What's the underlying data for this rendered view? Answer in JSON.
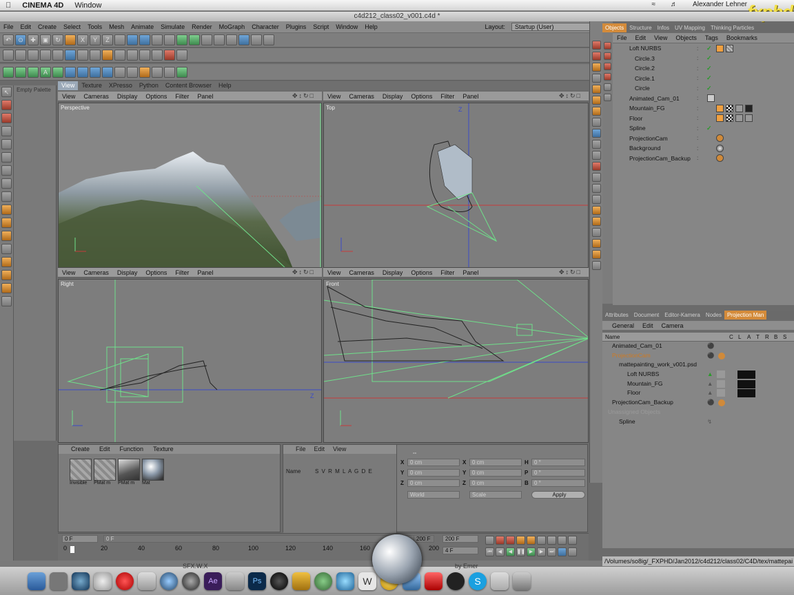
{
  "macbar": {
    "app": "CINEMA 4D",
    "window_menu": "Window",
    "user": "Alexander Lehner"
  },
  "watermark": "fxphd",
  "window_title": "c4d212_class02_v001.c4d *",
  "main_menu": [
    "File",
    "Edit",
    "Create",
    "Select",
    "Tools",
    "Mesh",
    "Animate",
    "Simulate",
    "Render",
    "MoGraph",
    "Character",
    "Plugins",
    "Script",
    "Window",
    "Help"
  ],
  "layout": {
    "label": "Layout:",
    "value": "Startup (User)"
  },
  "palette_label": "Empty Palette",
  "viewport_tabs": [
    "View",
    "Texture",
    "XPresso",
    "Python",
    "Content Browser",
    "Help"
  ],
  "viewport_menu": [
    "View",
    "Cameras",
    "Display",
    "Options",
    "Filter",
    "Panel"
  ],
  "viewports": {
    "perspective": "Perspective",
    "top": "Top",
    "right": "Right",
    "front": "Front"
  },
  "objects_tabs": [
    "Objects",
    "Structure",
    "Infos",
    "UV Mapping",
    "Thinking Particles"
  ],
  "objects_menu": [
    "File",
    "Edit",
    "View",
    "Objects",
    "Tags",
    "Bookmarks"
  ],
  "objects": [
    {
      "name": "Loft NURBS",
      "indent": 0,
      "check": true
    },
    {
      "name": "Circle.3",
      "indent": 1,
      "check": true
    },
    {
      "name": "Circle.2",
      "indent": 1,
      "check": true
    },
    {
      "name": "Circle.1",
      "indent": 1,
      "check": true
    },
    {
      "name": "Circle",
      "indent": 1,
      "check": true
    },
    {
      "name": "Animated_Cam_01",
      "indent": 0,
      "check": false
    },
    {
      "name": "Mountain_FG",
      "indent": 0,
      "check": false
    },
    {
      "name": "Floor",
      "indent": 0,
      "check": false
    },
    {
      "name": "Spline",
      "indent": 0,
      "check": true
    },
    {
      "name": "ProjectionCam",
      "indent": 0,
      "check": false
    },
    {
      "name": "Background",
      "indent": 0,
      "check": false
    },
    {
      "name": "ProjectionCam_Backup",
      "indent": 0,
      "check": false
    }
  ],
  "attr_tabs": [
    "Attributes",
    "Document",
    "Editor-Kamera",
    "Nodes",
    "Projection Man"
  ],
  "attr_menu": [
    "General",
    "Edit",
    "Camera"
  ],
  "attr_header": {
    "name": "Name",
    "cols": [
      "C",
      "L",
      "A",
      "T",
      "R",
      "B",
      "S"
    ]
  },
  "projection_items": [
    {
      "name": "Animated_Cam_01",
      "indent": 0,
      "color": "#111"
    },
    {
      "name": "ProjectionCam",
      "indent": 0,
      "color": "#d07a20"
    },
    {
      "name": "mattepainting_work_v001.psd",
      "indent": 1,
      "color": "#111"
    },
    {
      "name": "Loft NURBS",
      "indent": 2,
      "color": "#111"
    },
    {
      "name": "Mountain_FG",
      "indent": 2,
      "color": "#111"
    },
    {
      "name": "Floor",
      "indent": 2,
      "color": "#111"
    },
    {
      "name": "ProjectionCam_Backup",
      "indent": 0,
      "color": "#111"
    },
    {
      "name": "Unassigned Objects",
      "indent": 0,
      "color": "#9a9a9a"
    },
    {
      "name": "Spline",
      "indent": 1,
      "color": "#111"
    }
  ],
  "path": "/Volumes/so8ig/_FXPHD/Jan2012/c4d212/class02/C4D/tex/mattepai",
  "material_menu": [
    "Create",
    "Edit",
    "Function",
    "Texture"
  ],
  "materials": [
    "Invisible",
    "PMat m",
    "PMat m",
    "Mat"
  ],
  "layer_menu": [
    "File",
    "Edit",
    "View"
  ],
  "layer_header": {
    "name": "Name",
    "cols": "S V R M L A G D E"
  },
  "coords": {
    "x": "X",
    "y": "Y",
    "z": "Z",
    "pos_x": "0 cm",
    "pos_y": "0 cm",
    "pos_z": "0 cm",
    "size_x": "0 cm",
    "size_y": "0 cm",
    "size_z": "0 cm",
    "h": "H",
    "p": "P",
    "b": "B",
    "rot_h": "0 °",
    "rot_p": "0 °",
    "rot_b": "0 °",
    "world": "World",
    "scale": "Scale",
    "apply": "Apply",
    "dashes": "--"
  },
  "timeline": {
    "start": "0 F",
    "start2": "0 F",
    "end": "200 F",
    "end2": "200 F",
    "current": "4 F",
    "ticks": [
      "0",
      "20",
      "40",
      "60",
      "80",
      "100",
      "120",
      "140",
      "160",
      "180",
      "200"
    ]
  },
  "dock_text": {
    "left": "SFX.W.X",
    "right": "by Emer"
  },
  "colors": {
    "accent": "#d48b3a",
    "grid_green": "#6fe08a",
    "axis_red": "#c83a3a",
    "axis_blue": "#3a4ac8"
  }
}
